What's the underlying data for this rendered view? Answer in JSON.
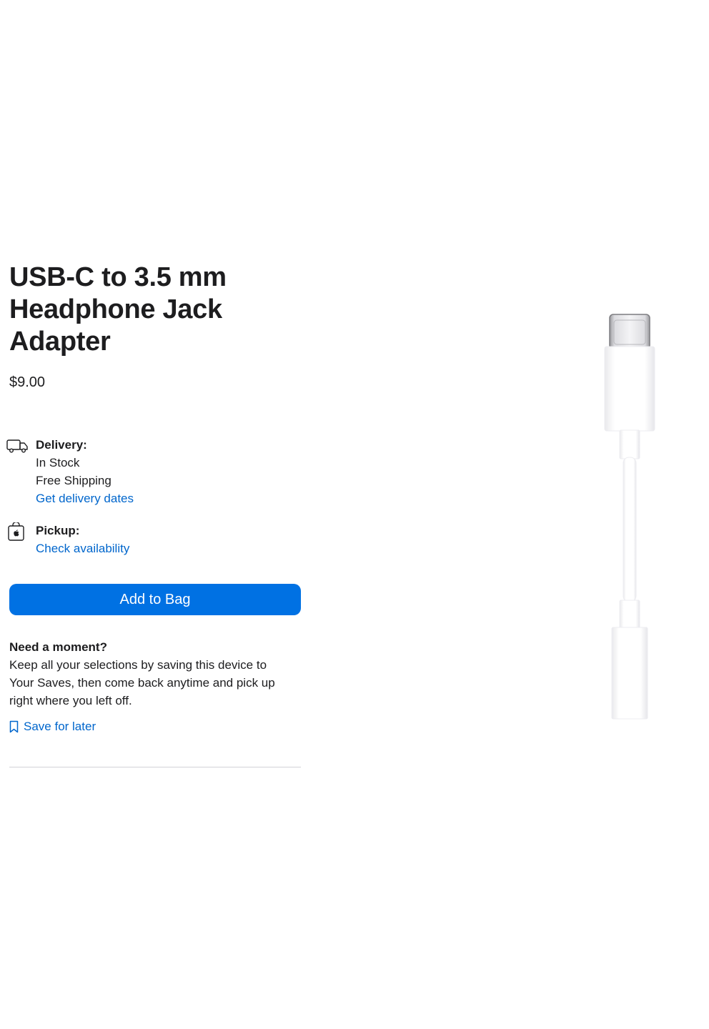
{
  "product": {
    "title": "USB-C to 3.5 mm Headphone Jack Adapter",
    "price": "$9.00"
  },
  "delivery": {
    "icon": "delivery-truck-icon",
    "label": "Delivery:",
    "stock": "In Stock",
    "shipping": "Free Shipping",
    "link": "Get delivery dates"
  },
  "pickup": {
    "icon": "store-bag-icon",
    "label": "Pickup:",
    "link": "Check availability"
  },
  "add_to_bag": {
    "label": "Add to Bag",
    "color": "#0071e3"
  },
  "save": {
    "title": "Need a moment?",
    "body": "Keep all your selections by saving this device to Your Saves, then come back anytime and pick up right where you left off.",
    "link": "Save for later",
    "icon": "bookmark-icon"
  },
  "colors": {
    "link": "#0066cc",
    "text": "#1d1d1f",
    "divider": "#d2d2d7"
  }
}
